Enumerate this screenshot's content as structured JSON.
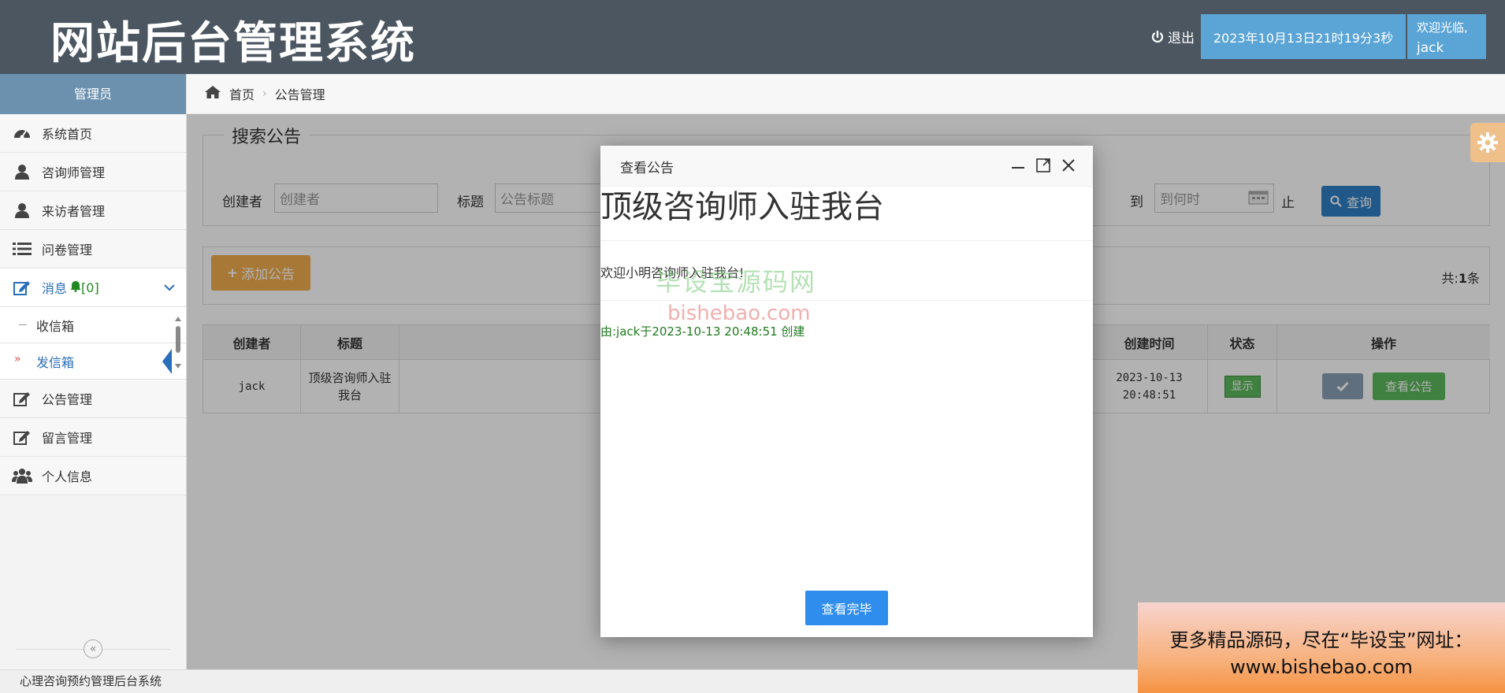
{
  "header": {
    "title": "网站后台管理系统",
    "logout": "退出",
    "datetime": "2023年10月13日21时19分3秒",
    "welcome": "欢迎光临,",
    "username": "jack"
  },
  "sidebar": {
    "role": "管理员",
    "items": [
      {
        "label": "系统首页",
        "icon": "dashboard-icon"
      },
      {
        "label": "咨询师管理",
        "icon": "user-icon"
      },
      {
        "label": "来访者管理",
        "icon": "user-icon"
      },
      {
        "label": "问卷管理",
        "icon": "list-icon"
      }
    ],
    "message": {
      "label": "消息",
      "count": "[0]"
    },
    "sub_items": [
      {
        "label": "收信箱"
      },
      {
        "label": "发信箱"
      }
    ],
    "items2": [
      {
        "label": "公告管理",
        "icon": "edit-icon"
      },
      {
        "label": "留言管理",
        "icon": "edit-icon"
      },
      {
        "label": "个人信息",
        "icon": "users-icon"
      }
    ]
  },
  "breadcrumb": {
    "home": "首页",
    "current": "公告管理"
  },
  "search": {
    "legend": "搜索公告",
    "creator_label": "创建者",
    "creator_placeholder": "创建者",
    "title_label": "标题",
    "title_placeholder": "公告标题",
    "to_label": "到",
    "to_placeholder": "到何时",
    "stop_suffix": "止",
    "query_button": "查询"
  },
  "toolbar": {
    "add_button": "添加公告",
    "total_prefix": "共:",
    "total_count": "1",
    "total_suffix": "条"
  },
  "table": {
    "headers": [
      "创建者",
      "标题",
      "创建时间",
      "状态",
      "操作"
    ],
    "rows": [
      {
        "creator": "jack",
        "title": "顶级咨询师入驻我台",
        "created": "2023-10-13 20:48:51",
        "status": "显示",
        "view_button": "查看公告"
      }
    ]
  },
  "modal": {
    "title": "查看公告",
    "heading": "顶级咨询师入驻我台",
    "body": "欢迎小明咨询师入驻我台!",
    "meta": "由:jack于2023-10-13 20:48:51 创建",
    "done_button": "查看完毕"
  },
  "watermark": {
    "cn": "毕设宝源码网",
    "en": "bishebao.com"
  },
  "footer": {
    "text": "心理咨询预约管理后台系统"
  },
  "promo": {
    "line1": "更多精品源码，尽在“毕设宝”网址：",
    "line2": "www.bishebao.com"
  },
  "colors": {
    "header": "#4b5661",
    "accent": "#5aa4d6",
    "primary": "#2f7fc6",
    "warning": "#f0ad4e",
    "success": "#5cb85c"
  }
}
